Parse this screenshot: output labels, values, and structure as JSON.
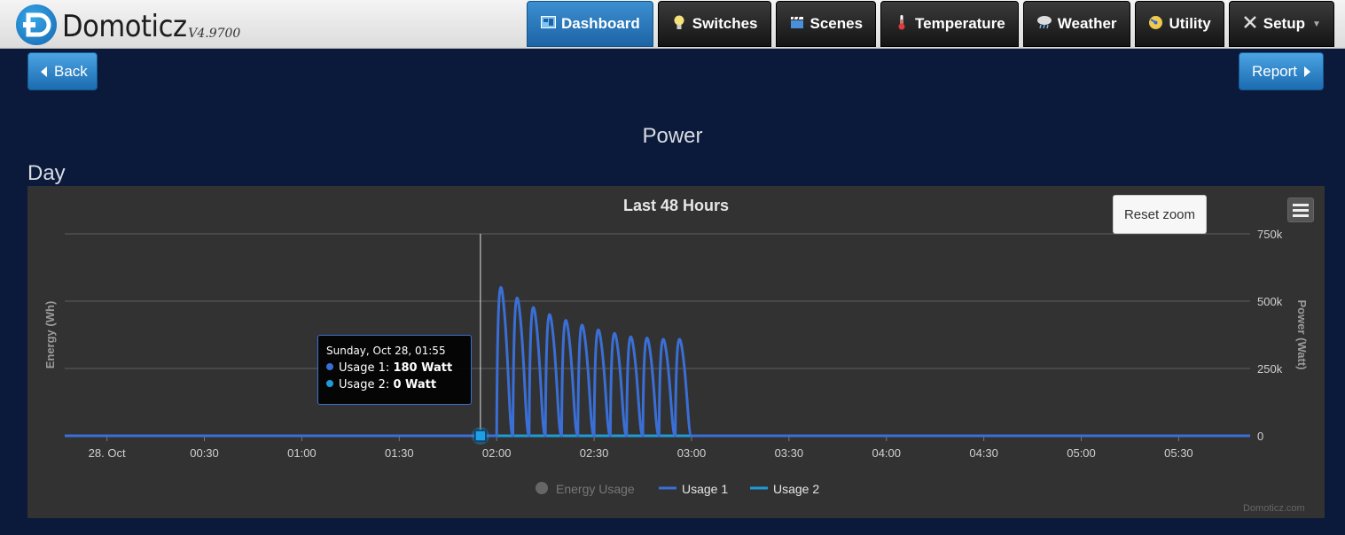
{
  "app": {
    "name": "Domoticz",
    "version": "V4.9700"
  },
  "nav": [
    {
      "label": "Dashboard",
      "icon": "dashboard-icon",
      "active": true
    },
    {
      "label": "Switches",
      "icon": "lightbulb-icon",
      "active": false
    },
    {
      "label": "Scenes",
      "icon": "clapperboard-icon",
      "active": false
    },
    {
      "label": "Temperature",
      "icon": "thermometer-icon",
      "active": false
    },
    {
      "label": "Weather",
      "icon": "cloud-rain-icon",
      "active": false
    },
    {
      "label": "Utility",
      "icon": "gauge-icon",
      "active": false
    },
    {
      "label": "Setup",
      "icon": "tools-icon",
      "active": false
    }
  ],
  "buttons": {
    "back": "Back",
    "report": "Report",
    "reset_zoom": "Reset zoom"
  },
  "page": {
    "title": "Power",
    "section": "Day"
  },
  "tooltip": {
    "date": "Sunday, Oct 28, 01:55",
    "rows": [
      {
        "name": "Usage 1",
        "value": "180 Watt",
        "color": "#3a6fd6"
      },
      {
        "name": "Usage 2",
        "value": "0 Watt",
        "color": "#1f9ad6"
      }
    ]
  },
  "credit": "Domoticz.com",
  "chart_data": {
    "type": "line",
    "title": "Last 48 Hours",
    "ylabel_left": "Energy (Wh)",
    "ylabel_right": "Power (Watt)",
    "y_ticks": [
      "0",
      "250k",
      "500k",
      "750k"
    ],
    "ylim": [
      0,
      750000
    ],
    "x_ticks": [
      "28. Oct",
      "00:30",
      "01:00",
      "01:30",
      "02:00",
      "02:30",
      "03:00",
      "03:30",
      "04:00",
      "04:30",
      "05:00",
      "05:30"
    ],
    "xlim": [
      "Oct 27 23:47",
      "Oct 28 05:52"
    ],
    "grid": true,
    "legend_position": "bottom",
    "series": [
      {
        "name": "Energy Usage",
        "color": "#666666",
        "hidden": true,
        "points": []
      },
      {
        "name": "Usage 1",
        "color": "#3a6fd6",
        "points": [
          {
            "t": "Oct 28 01:55",
            "v": 180
          },
          {
            "t": "Oct 28 01:59",
            "v": 0
          },
          {
            "t": "Oct 28 02:00",
            "v": 630000
          },
          {
            "t": "Oct 28 02:05",
            "v": 585000
          },
          {
            "t": "Oct 28 02:10",
            "v": 545000
          },
          {
            "t": "Oct 28 02:15",
            "v": 515000
          },
          {
            "t": "Oct 28 02:20",
            "v": 490000
          },
          {
            "t": "Oct 28 02:25",
            "v": 470000
          },
          {
            "t": "Oct 28 02:30",
            "v": 450000
          },
          {
            "t": "Oct 28 02:35",
            "v": 435000
          },
          {
            "t": "Oct 28 02:40",
            "v": 420000
          },
          {
            "t": "Oct 28 02:45",
            "v": 415000
          },
          {
            "t": "Oct 28 02:50",
            "v": 410000
          },
          {
            "t": "Oct 28 02:55",
            "v": 410000
          },
          {
            "t": "Oct 28 03:00",
            "v": 0
          }
        ]
      },
      {
        "name": "Usage 2",
        "color": "#1f9ad6",
        "points": [
          {
            "t": "Oct 27 23:47",
            "v": 0
          },
          {
            "t": "Oct 28 05:52",
            "v": 0
          }
        ]
      }
    ]
  }
}
